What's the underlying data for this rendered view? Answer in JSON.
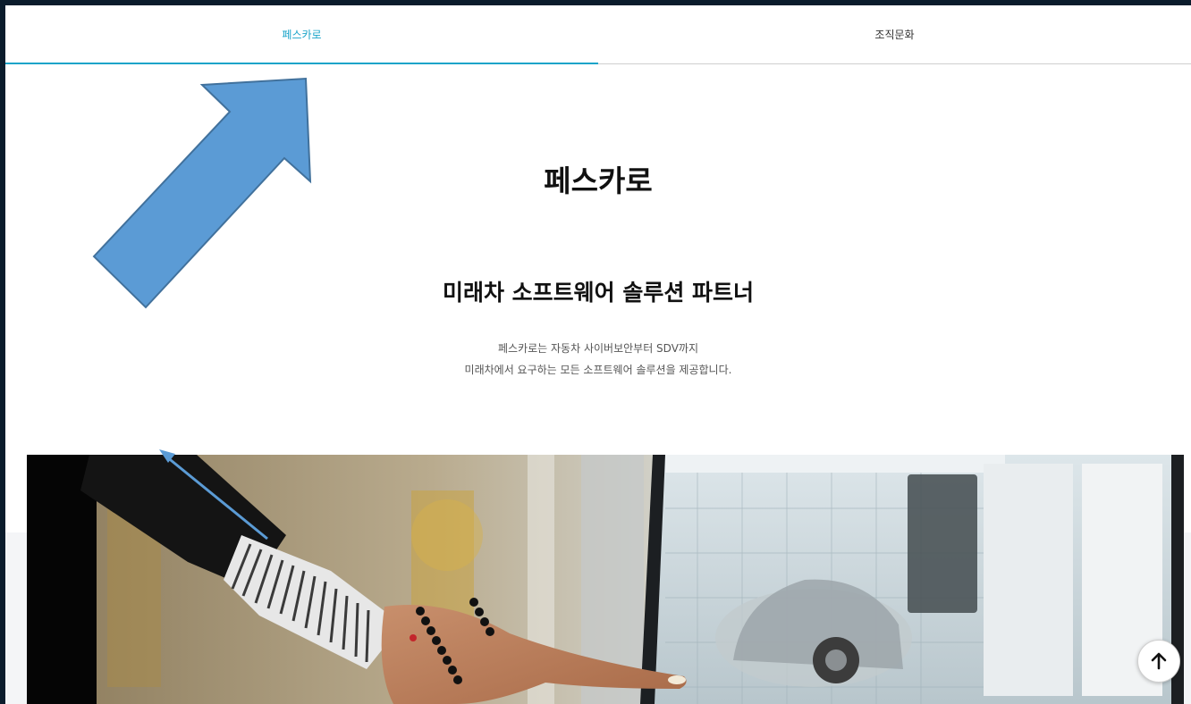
{
  "tabs": [
    {
      "label": "페스카로",
      "active": true
    },
    {
      "label": "조직문화",
      "active": false
    }
  ],
  "main": {
    "title": "페스카로",
    "subtitle": "미래차 소프트웨어 솔루션 파트너",
    "description_line1": "페스카로는 자동차 사이버보안부터 SDV까지",
    "description_line2": "미래차에서 요구하는 모든 소프트웨어 솔루션을 제공합니다."
  },
  "icons": {
    "scroll_top": "arrow-up-icon"
  },
  "colors": {
    "accent": "#1aa4c9",
    "annotation_arrow": "#5b9bd5",
    "annotation_arrow_stroke": "#41719c",
    "frame_background": "#0b1c2c"
  }
}
